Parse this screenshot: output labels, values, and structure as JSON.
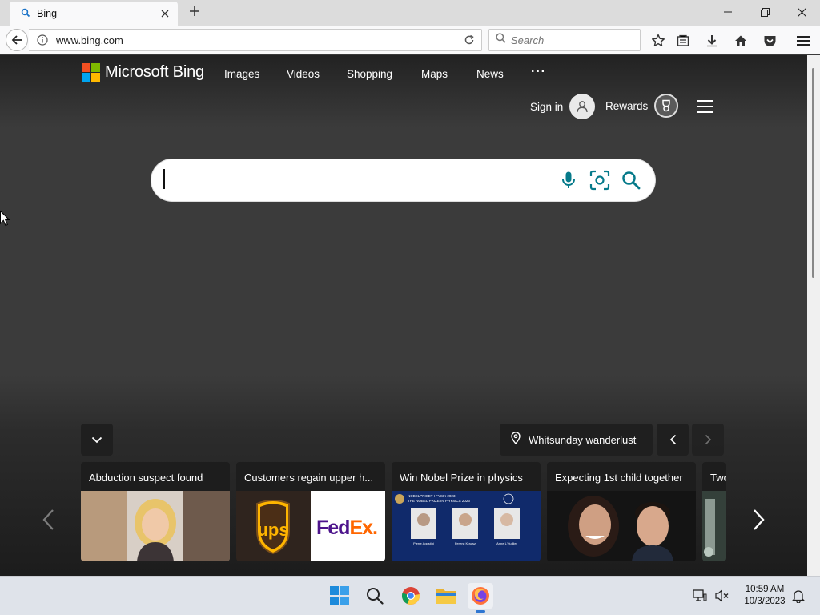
{
  "browser": {
    "tab_title": "Bing",
    "url": "www.bing.com",
    "search_placeholder": "Search"
  },
  "bing": {
    "logo_text": "Microsoft Bing",
    "nav": [
      "Images",
      "Videos",
      "Shopping",
      "Maps",
      "News"
    ],
    "more_label": "···",
    "signin_label": "Sign in",
    "rewards_label": "Rewards",
    "search_value": "",
    "location_label": "Whitsunday wanderlust",
    "news_cards": [
      {
        "title": "Abduction suspect found"
      },
      {
        "title": "Customers regain upper h..."
      },
      {
        "title": "Win Nobel Prize in physics"
      },
      {
        "title": "Expecting 1st child together"
      },
      {
        "title": "Two"
      }
    ],
    "nobel_lines": [
      "NOBELPRISET I FYSIK 2023",
      "THE NOBEL PRIZE IN PHYSICS 2023"
    ],
    "laureates": [
      "Pierre Agostini",
      "Ferenc Krausz",
      "Anne L'Huillier"
    ],
    "ups_text": "ups",
    "fedex": {
      "fed": "Fed",
      "ex": "Ex",
      "dot": "."
    }
  },
  "taskbar": {
    "time": "10:59 AM",
    "date": "10/3/2023"
  },
  "colors": {
    "ms_red": "#f25022",
    "ms_green": "#7fba00",
    "ms_blue": "#00a4ef",
    "ms_yellow": "#ffb900",
    "bing_teal": "#067a8a"
  }
}
